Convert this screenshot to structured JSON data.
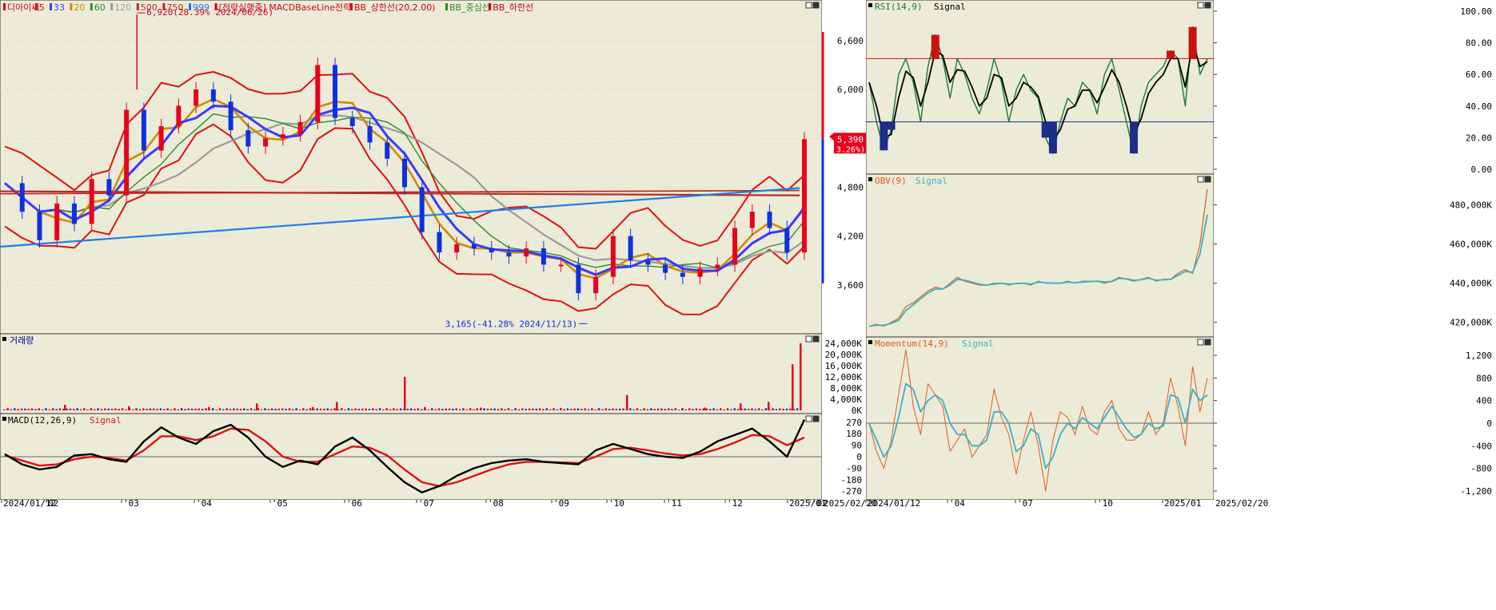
{
  "colors": {
    "panel_bg": "#ecebd8",
    "axis_bg": "#ffffff",
    "grid": "#bdbcae",
    "border": "#333333",
    "up": "#e8001c",
    "down": "#1030e0",
    "ma5": "#e8001c",
    "ma20": "#d28a00",
    "ma33": "#3a3aff",
    "ma60": "#2a8c2a",
    "ma120": "#9a9a9a",
    "ma500": "#b0302a",
    "ma750": "#c02020",
    "ma999": "#1e7ee8",
    "bb": "#e01010",
    "rsi": "#1a7a3a",
    "obv": "#e05a1a",
    "obv_signal": "#3ab0c8",
    "macd": "#000000",
    "macd_signal": "#e01010",
    "zone_red": "#cc1010",
    "zone_blue": "#1b2e8a"
  },
  "main_chart": {
    "legend": [
      {
        "text": "디아이씨",
        "color": "#d0001a"
      },
      {
        "text": "5",
        "color": "#e8001c"
      },
      {
        "text": "33",
        "color": "#3a3aff"
      },
      {
        "text": "20",
        "color": "#d28a00"
      },
      {
        "text": "60",
        "color": "#2a8c2a"
      },
      {
        "text": "120",
        "color": "#9a9a9a"
      },
      {
        "text": "500",
        "color": "#b0302a"
      },
      {
        "text": "750",
        "color": "#c02020"
      },
      {
        "text": "999",
        "color": "#1e7ee8"
      },
      {
        "text": "[전략실행중] MACDBaseLine전략",
        "color": "#d0001a"
      },
      {
        "text": "BB_상한선(20,2.00)",
        "color": "#d0001a"
      },
      {
        "text": "BB_중심선",
        "color": "#2a8c2a"
      },
      {
        "text": "BB_하한선",
        "color": "#d0001a"
      }
    ],
    "high_annotation": "6,920(28.39% 2024/06/26)",
    "low_annotation": "3,165(-41.28% 2024/11/13)",
    "y_ticks": [
      "6,600",
      "6,000",
      "5,400",
      "4,800",
      "4,200",
      "3,600"
    ],
    "current_price": "5,390",
    "current_change": "( 3.26%)",
    "x_labels": [
      "2024/01/12",
      "02",
      "'03",
      "'04",
      "'05",
      "'06",
      "'07",
      "'08",
      "'09",
      "'10",
      "'11",
      "'12",
      "2025/01",
      "'02",
      "2025/02/20"
    ]
  },
  "volume_panel": {
    "title": "거래량",
    "y_ticks": [
      "24,000K",
      "20,000K",
      "16,000K",
      "12,000K",
      "8,000K",
      "4,000K",
      "0K"
    ]
  },
  "macd_panel": {
    "legend_main": "MACD(12,26,9)",
    "legend_signal": "Signal",
    "y_ticks": [
      "270",
      "180",
      "90",
      "0",
      "-90",
      "-180",
      "-270"
    ]
  },
  "rsi_panel": {
    "legend_main": "RSI(14,9)",
    "legend_signal": "Signal",
    "y_ticks": [
      "100.00",
      "80.00",
      "60.00",
      "40.00",
      "20.00",
      "0.00"
    ],
    "upper_level": 70,
    "lower_level": 30
  },
  "obv_panel": {
    "legend_main": "OBV(9)",
    "legend_signal": "Signal",
    "y_ticks": [
      "480,000K",
      "460,000K",
      "440,000K",
      "420,000K"
    ]
  },
  "momentum_panel": {
    "legend_main": "Momentum(14,9)",
    "legend_signal": "Signal",
    "y_ticks": [
      "1,200",
      "800",
      "400",
      "0",
      "-400",
      "-800",
      "-1,200"
    ],
    "x_labels": [
      "2024/01/12",
      "'04",
      "'07",
      "'10",
      "2025/01",
      "2025/02/20"
    ]
  },
  "chart_data": [
    {
      "type": "candlestick",
      "title": "디아이씨",
      "ylim": [
        3100,
        7000
      ],
      "x": [
        "2024/01",
        "2024/02",
        "2024/03",
        "2024/04",
        "2024/05",
        "2024/06",
        "2024/07",
        "2024/08",
        "2024/09",
        "2024/10",
        "2024/11",
        "2024/12",
        "2025/01",
        "2025/02"
      ],
      "close_path": [
        4850,
        4500,
        4150,
        4600,
        4350,
        4900,
        4700,
        5750,
        5250,
        5550,
        5800,
        6000,
        5850,
        5500,
        5300,
        5400,
        5450,
        5600,
        6300,
        5650,
        5550,
        5350,
        5150,
        4800,
        4250,
        4000,
        4100,
        4050,
        4000,
        3950,
        4050,
        3850,
        3850,
        3500,
        3700,
        4200,
        3900,
        3850,
        3750,
        3700,
        3800,
        3850,
        4300,
        4500,
        4300,
        4000,
        5390
      ],
      "high": 6920,
      "low": 3165,
      "last_close": 5390,
      "change_pct": 3.26
    },
    {
      "type": "bar",
      "title": "거래량",
      "unit": "K",
      "ylim": [
        0,
        24000
      ],
      "spikes": [
        2000,
        1500,
        1200,
        2500,
        1200,
        3000,
        12000,
        1200,
        1000,
        900,
        5500,
        1000,
        2500,
        3000,
        16500,
        24000
      ]
    },
    {
      "type": "line",
      "title": "MACD(12,26,9)",
      "ylim": [
        -300,
        300
      ],
      "series": [
        {
          "name": "MACD(12,26,9)",
          "values": [
            20,
            -60,
            -100,
            -80,
            10,
            20,
            -20,
            -40,
            120,
            230,
            150,
            100,
            200,
            250,
            150,
            0,
            -80,
            -30,
            -60,
            80,
            150,
            50,
            -80,
            -200,
            -280,
            -230,
            -150,
            -90,
            -50,
            -30,
            -20,
            -40,
            -50,
            -60,
            50,
            100,
            60,
            20,
            0,
            -10,
            40,
            120,
            170,
            220,
            120,
            0,
            290
          ]
        },
        {
          "name": "Signal",
          "values": [
            10,
            -30,
            -70,
            -60,
            -20,
            0,
            -10,
            -30,
            50,
            160,
            160,
            130,
            160,
            220,
            210,
            120,
            0,
            -40,
            -40,
            20,
            80,
            70,
            10,
            -100,
            -200,
            -230,
            -200,
            -150,
            -100,
            -60,
            -40,
            -40,
            -45,
            -50,
            0,
            60,
            70,
            50,
            25,
            10,
            20,
            60,
            110,
            170,
            160,
            90,
            150
          ]
        }
      ]
    },
    {
      "type": "line",
      "title": "RSI(14,9)",
      "ylim": [
        0,
        100
      ],
      "series": [
        {
          "name": "RSI(14,9)",
          "values": [
            55,
            30,
            12,
            25,
            60,
            70,
            55,
            30,
            65,
            85,
            70,
            45,
            70,
            60,
            45,
            35,
            50,
            70,
            55,
            30,
            50,
            60,
            50,
            45,
            20,
            10,
            30,
            45,
            40,
            55,
            50,
            35,
            60,
            70,
            50,
            30,
            10,
            40,
            55,
            60,
            65,
            75,
            70,
            40,
            90,
            60,
            70
          ]
        },
        {
          "name": "Signal",
          "values": [
            55,
            40,
            20,
            22,
            45,
            62,
            58,
            40,
            55,
            75,
            72,
            55,
            63,
            62,
            52,
            40,
            45,
            60,
            58,
            40,
            45,
            55,
            52,
            46,
            30,
            18,
            25,
            38,
            40,
            50,
            50,
            42,
            52,
            63,
            55,
            40,
            22,
            32,
            48,
            55,
            60,
            70,
            70,
            52,
            80,
            65,
            68
          ]
        }
      ]
    },
    {
      "type": "line",
      "title": "OBV(9)",
      "unit": "K",
      "ylim": [
        415000,
        490000
      ],
      "series": [
        {
          "name": "OBV(9)",
          "values": [
            418000,
            419000,
            418000,
            420000,
            422000,
            428000,
            430000,
            433000,
            436000,
            438000,
            437000,
            440000,
            443000,
            441000,
            440000,
            439000,
            439000,
            440000,
            440000,
            439000,
            440000,
            440000,
            439000,
            441000,
            440000,
            440000,
            440000,
            441000,
            440000,
            441000,
            441000,
            441000,
            440000,
            441000,
            443000,
            442000,
            441000,
            442000,
            443000,
            441000,
            442000,
            442000,
            445000,
            447000,
            445000,
            460000,
            488000
          ]
        },
        {
          "name": "Signal",
          "values": [
            418000,
            418500,
            418500,
            419500,
            421000,
            426000,
            429000,
            432000,
            435000,
            437000,
            437000,
            439000,
            442000,
            441500,
            440500,
            439500,
            439000,
            439500,
            440000,
            439500,
            439800,
            440000,
            439500,
            440500,
            440200,
            440000,
            440000,
            440500,
            440200,
            440600,
            440800,
            441000,
            440600,
            440800,
            442500,
            442200,
            441500,
            441800,
            442500,
            441500,
            441800,
            442000,
            444000,
            446000,
            445500,
            455000,
            475000
          ]
        }
      ]
    },
    {
      "type": "line",
      "title": "Momentum(14,9)",
      "ylim": [
        -1300,
        1300
      ],
      "series": [
        {
          "name": "Momentum(14,9)",
          "values": [
            0,
            -500,
            -800,
            -300,
            500,
            1300,
            300,
            -200,
            700,
            500,
            300,
            -500,
            -300,
            -100,
            -600,
            -400,
            -200,
            600,
            100,
            -200,
            -900,
            -300,
            200,
            -400,
            -1200,
            -300,
            200,
            100,
            -200,
            300,
            -100,
            -200,
            200,
            400,
            -100,
            -300,
            -300,
            -200,
            200,
            -200,
            0,
            800,
            300,
            -400,
            1000,
            200,
            800
          ]
        },
        {
          "name": "Signal",
          "values": [
            0,
            -300,
            -600,
            -400,
            100,
            700,
            600,
            200,
            400,
            500,
            400,
            0,
            -200,
            -200,
            -400,
            -400,
            -300,
            200,
            200,
            0,
            -500,
            -400,
            -100,
            -200,
            -800,
            -600,
            -200,
            0,
            -100,
            100,
            0,
            -100,
            100,
            300,
            100,
            -100,
            -250,
            -200,
            0,
            -100,
            -50,
            500,
            450,
            0,
            600,
            400,
            500
          ]
        }
      ]
    }
  ]
}
